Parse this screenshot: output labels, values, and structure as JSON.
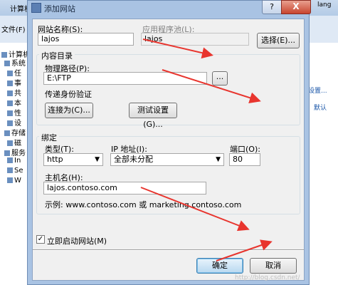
{
  "background": {
    "title_text": "计算机",
    "menu_file": "文件(F)",
    "tree_items": [
      "计算机",
      "系统",
      "任",
      "事",
      "共",
      "本",
      "性",
      "设",
      "存储",
      "磁",
      "服务",
      "In",
      "Se",
      "W"
    ],
    "right_texts": [
      "设置...",
      "默认",
      "lang"
    ]
  },
  "dialog": {
    "title": "添加网站",
    "help": "?",
    "close": "X",
    "site_name_label": "网站名称(S):",
    "site_name_value": "lajos",
    "app_pool_label": "应用程序池(L):",
    "app_pool_value": "lajos",
    "select_button": "选择(E)...",
    "content_dir_title": "内容目录",
    "physical_path_label": "物理路径(P):",
    "physical_path_value": "E:\\FTP",
    "browse_button": "...",
    "pass_auth_label": "传递身份验证",
    "connect_as_button": "连接为(C)...",
    "test_settings_button": "测试设置(G)...",
    "binding_title": "绑定",
    "type_label": "类型(T):",
    "type_value": "http",
    "ip_label": "IP 地址(I):",
    "ip_value": "全部未分配",
    "port_label": "端口(O):",
    "port_value": "80",
    "hostname_label": "主机名(H):",
    "hostname_value": "lajos.contoso.com",
    "example_text": "示例: www.contoso.com 或 marketing.contoso.com",
    "start_checkbox_label": "立即启动网站(M)",
    "start_checked": true,
    "ok_button": "确定",
    "cancel_button": "取消",
    "watermark": "http://blog.csdn.net/"
  },
  "colors": {
    "annotation_arrow": "#e8352e"
  }
}
